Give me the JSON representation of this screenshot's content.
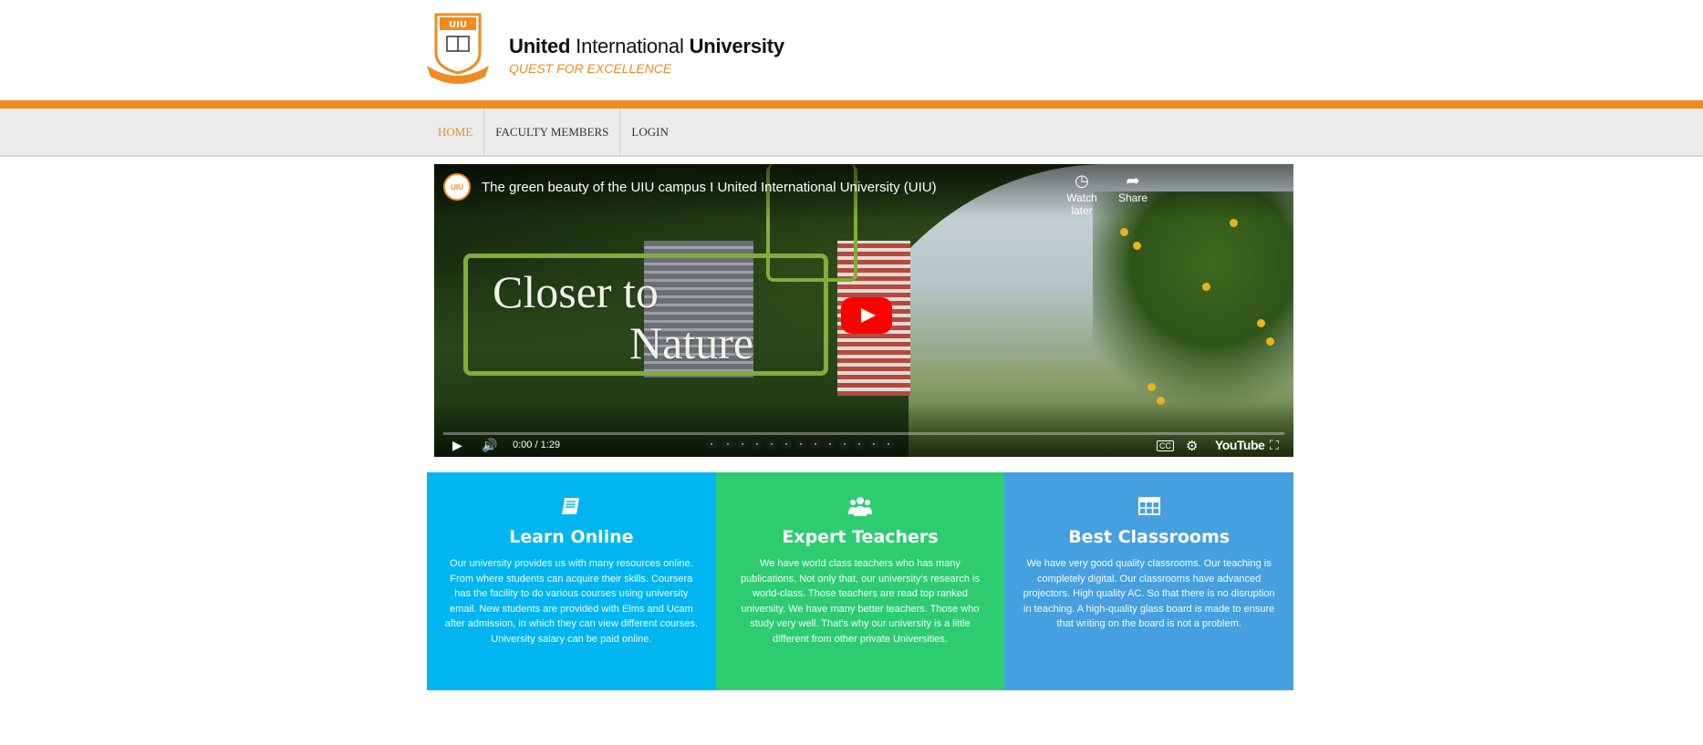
{
  "header": {
    "logo_text": "UIU",
    "brand_name_a": "United",
    "brand_name_b": " International ",
    "brand_name_c": "University",
    "tagline": "QUEST FOR EXCELLENCE"
  },
  "nav": {
    "items": [
      {
        "label": "HOME"
      },
      {
        "label": "FACULTY MEMBERS"
      },
      {
        "label": "LOGIN"
      }
    ]
  },
  "video": {
    "channel": "UIU",
    "title": "The green beauty of the UIU campus I United International University (UIU)",
    "headline_line1": "Closer to",
    "headline_line2": "Nature",
    "watch_later": "Watch later",
    "share": "Share",
    "time": "0:00 / 1:29",
    "youtube_label": "YouTube",
    "cc_label": "CC"
  },
  "cards": [
    {
      "title": "Learn Online",
      "icon": "book-icon",
      "text": "Our university provides us with many resources online. From where students can acquire their skills. Coursera has the facility to do various courses using university email. New students are provided with Elms and Ucam after admission, in which they can view different courses. University salary can be paid online.",
      "color": "#00b5f0"
    },
    {
      "title": "Expert Teachers",
      "icon": "group-icon",
      "text": "We have world class teachers who has many publications. Not only that, our university's research is world-class. Those teachers are read top ranked university. We have many better teachers. Those who study very well. That's why our university is a little different from other private Universities.",
      "color": "#2ecc71"
    },
    {
      "title": "Best Classrooms",
      "icon": "table-icon",
      "text": "We have very good quality classrooms. Our teaching is completely digital. Our classrooms have advanced projectors. High quality AC. So that there is no disruption in teaching. A high-quality glass board is made to ensure that writing on the board is not a problem.",
      "color": "#46a0e0"
    }
  ],
  "colors": {
    "accent_orange": "#f08a1e",
    "nav_bg": "#ececec"
  }
}
